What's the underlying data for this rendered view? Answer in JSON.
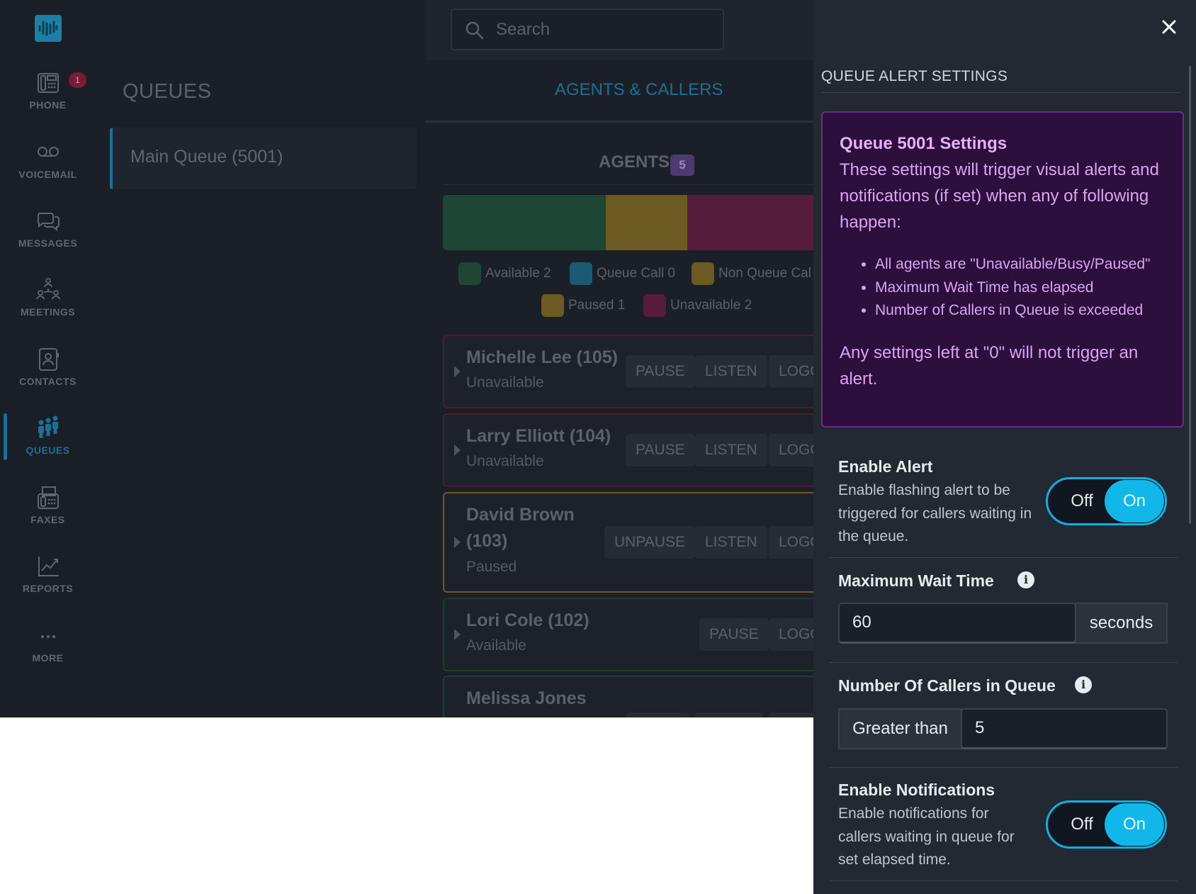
{
  "nav": {
    "items": [
      {
        "label": "PHONE",
        "badge": "1"
      },
      {
        "label": "VOICEMAIL"
      },
      {
        "label": "MESSAGES"
      },
      {
        "label": "MEETINGS"
      },
      {
        "label": "CONTACTS"
      },
      {
        "label": "QUEUES",
        "active": true
      },
      {
        "label": "FAXES"
      },
      {
        "label": "REPORTS"
      },
      {
        "label": "MORE"
      }
    ]
  },
  "search": {
    "placeholder": "Search"
  },
  "queues": {
    "title": "QUEUES",
    "items": [
      {
        "label": "Main Queue (5001)"
      }
    ]
  },
  "main": {
    "tab": "AGENTS & CALLERS",
    "agents_header": "AGENTS",
    "agents_count": "5",
    "status_bar": [
      {
        "status": "Available",
        "count": 2,
        "color": "#1f4535"
      },
      {
        "status": "Paused",
        "count": 1,
        "color": "#6b5a22"
      },
      {
        "status": "Unavailable",
        "count": 2,
        "color": "#561d3a"
      }
    ],
    "legend": [
      {
        "label": "Available 2",
        "color": "#1f4535"
      },
      {
        "label": "Queue Call 0",
        "color": "#1c5a74"
      },
      {
        "label": "Non Queue Cal",
        "color": "#6b5a22"
      },
      {
        "label": "Paused 1",
        "color": "#6b5a22"
      },
      {
        "label": "Unavailable 2",
        "color": "#561d3a"
      }
    ],
    "agents": [
      {
        "name": "Michelle Lee (105)",
        "status": "Unavailable",
        "buttons": [
          "PAUSE",
          "LISTEN",
          "LOGO"
        ]
      },
      {
        "name": "Larry Elliott (104)",
        "status": "Unavailable",
        "buttons": [
          "PAUSE",
          "LISTEN",
          "LOGO"
        ]
      },
      {
        "name_line1": "David Brown",
        "name_line2": "(103)",
        "status": "Paused",
        "buttons": [
          "UNPAUSE",
          "LISTEN",
          "LOGO"
        ]
      },
      {
        "name": "Lori Cole (102)",
        "status": "Available",
        "buttons": [
          "PAUSE",
          "LOGO"
        ]
      },
      {
        "name": "Melissa Jones",
        "status": ""
      }
    ]
  },
  "panel": {
    "title": "QUEUE ALERT SETTINGS",
    "info": {
      "title": "Queue 5001 Settings",
      "description": "These settings will trigger visual alerts and notifications (if set) when any of following happen:",
      "bullets": [
        "All agents are \"Unavailable/Busy/Paused\"",
        "Maximum Wait Time has elapsed",
        "Number of Callers in Queue is exceeded"
      ],
      "note": "Any settings left at \"0\" will not trigger an alert."
    },
    "enable_alert": {
      "label": "Enable Alert",
      "description": "Enable flashing alert to be triggered for callers waiting in the queue.",
      "off": "Off",
      "on": "On"
    },
    "max_wait": {
      "label": "Maximum Wait Time",
      "value": "60",
      "unit": "seconds"
    },
    "callers": {
      "label": "Number Of Callers in Queue",
      "prefix": "Greater than",
      "value": "5"
    },
    "enable_notifications": {
      "label": "Enable Notifications",
      "description": "Enable notifications for callers waiting in queue for set elapsed time.",
      "off": "Off",
      "on": "On"
    }
  }
}
